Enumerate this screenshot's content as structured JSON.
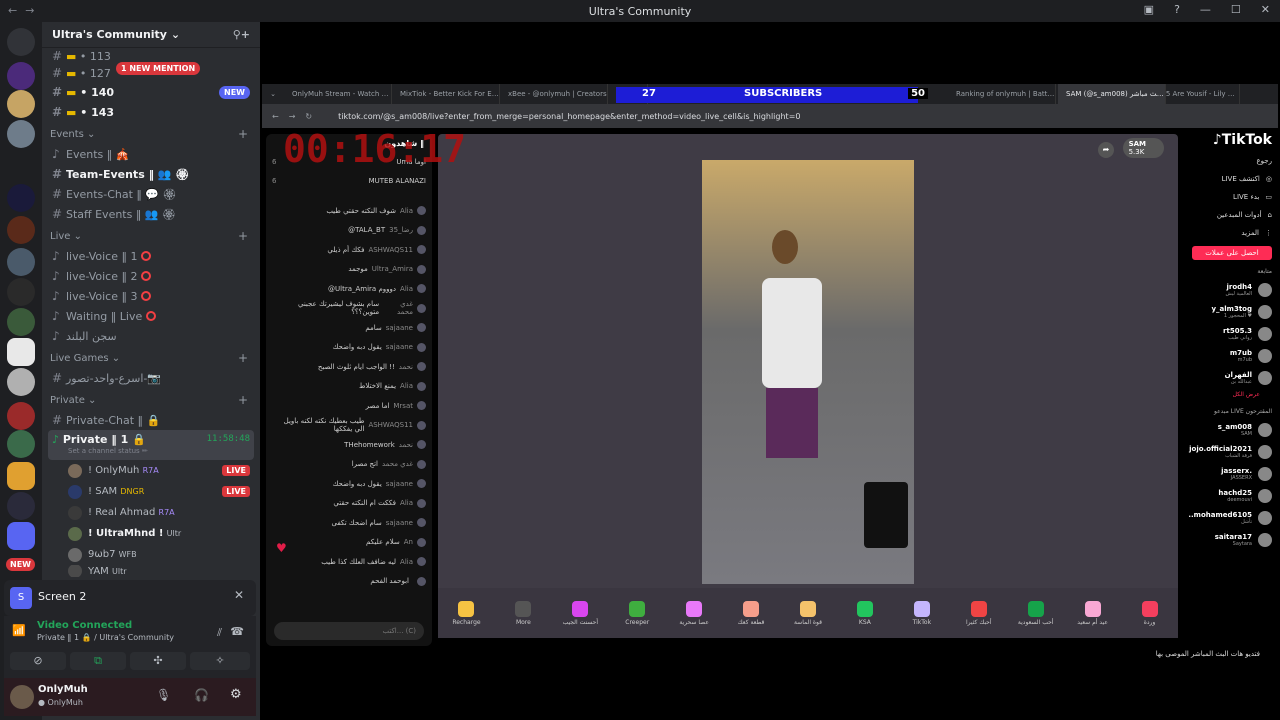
{
  "window": {
    "title": "Ultra's Community"
  },
  "guild": {
    "name": "Ultra's Community",
    "new_mention": "1 NEW MENTION"
  },
  "top_rows": [
    {
      "label": "• 113"
    },
    {
      "label": "• 127"
    },
    {
      "label": "• 140",
      "badge": "NEW"
    },
    {
      "label": "• 143"
    }
  ],
  "categories": {
    "events": "Events",
    "live": "Live",
    "live_games": "Live Games",
    "private": "Private"
  },
  "channels": {
    "events": [
      "Events ‖ 🎪",
      "Team-Events ‖ 👥 🏵",
      "Events-Chat ‖ 💬 🏵",
      "Staff Events ‖ 👥 🏵"
    ],
    "live": [
      "live-Voice ‖ 1",
      "live-Voice ‖ 2",
      "live-Voice ‖ 3",
      "Waiting ‖ Live",
      "سجن البلند"
    ],
    "live_games": [
      "اسرع-واحد-تصور-📷"
    ],
    "private_chat": "Private-Chat ‖ 🔒",
    "private_voice": "Private ‖ 1 🔒",
    "private_time": "11:58:48",
    "private_status": "Set a channel status ✏"
  },
  "voice_users": [
    {
      "name": "! OnlyMuh",
      "tag": "R7A",
      "live": "LIVE"
    },
    {
      "name": "! SAM",
      "tag": "DNGR",
      "live": "LIVE"
    },
    {
      "name": "! Real Ahmad",
      "tag": "R7A"
    },
    {
      "name": "! UltraMhnd !",
      "tag": "Ultr"
    },
    {
      "name": "9ωb7",
      "tag": "WFB"
    },
    {
      "name": "YAM",
      "tag": "Ultr"
    }
  ],
  "screen_panel": {
    "title": "Screen 2"
  },
  "voice_panel": {
    "status": "Video Connected",
    "detail": "Private ‖ 1 🔒 / Ultra's Community"
  },
  "user_panel": {
    "name": "OnlyMuh",
    "status": "● OnlyMuh",
    "new_badge": "NEW"
  },
  "browser": {
    "tabs": [
      "OnlyMuh Stream - Watch Live on K",
      "MixTiok - Better Kick For Everyone",
      "xBee - @onlymuh | Creators",
      "",
      "17755 Are Yousif - Lily of the",
      "Ranking of onlymuh | Battle -- C",
      "SAM (@s_am008) على بث مباشر"
    ],
    "url": "tiktok.com/@s_am008/live?enter_from_merge=personal_homepage&enter_method=video_live_cell&is_highlight=0"
  },
  "overlay": {
    "left_num": "27",
    "label": "SUBSCRIBERS",
    "right_num": "50",
    "timer": "00:16:17"
  },
  "chat": {
    "header": "شاهدون ‖",
    "top_viewers": [
      {
        "rank": "6",
        "name": "Uma اوما"
      },
      {
        "rank": "6",
        "name": "MUTEB ALANAZI"
      }
    ],
    "messages": [
      {
        "user": "Alia",
        "text": "شوف النكته حقتي طيب"
      },
      {
        "user": "رضا_35",
        "text": "@TALA_BT"
      },
      {
        "user": "ASHWAQS11",
        "text": "فكك أم ذيلي"
      },
      {
        "user": "Ultra_Amira",
        "text": "موجمد"
      },
      {
        "user": "Alia",
        "text": "@Ultra_Amira دوووم"
      },
      {
        "user": "غدي محمد",
        "text": "سام بشوف ليشيرتك عجبني متوين؟؟؟"
      },
      {
        "user": "sajaane",
        "text": "سامم"
      },
      {
        "user": "sajaane",
        "text": "يقول دبه واضحك"
      },
      {
        "user": "نحمد",
        "text": "الواجب ايام ثلوث الصبح !!"
      },
      {
        "user": "Alia",
        "text": "يمنع الاختلاط"
      },
      {
        "user": "Mrsat",
        "text": "اما مصر"
      },
      {
        "user": "ASHWAQS11",
        "text": "طيب بعطيك نكته لكنه باويل الي يفككها"
      },
      {
        "user": "نحمد",
        "text": "THehomework"
      },
      {
        "user": "غدي محمد",
        "text": "اتج مصرا"
      },
      {
        "user": "sajaane",
        "text": "يقول دبه واضحك"
      },
      {
        "user": "Alia",
        "text": "فككت ام النكته حقتي"
      },
      {
        "user": "sajaane",
        "text": "سام اضحك تكفى"
      },
      {
        "user": "An",
        "text": "سلام عليكم"
      },
      {
        "user": "Alia",
        "text": "ليه ضافف العلك كذا طيب"
      },
      {
        "user": "",
        "text": "ابوحمد الفحم"
      }
    ],
    "input_placeholder": "اكتب... (C)"
  },
  "stream_header": {
    "name": "SAM",
    "viewers": "5.3K"
  },
  "gifts": [
    {
      "label": "Recharge",
      "color": "#f6c343"
    },
    {
      "label": "More",
      "color": "#555555"
    },
    {
      "label": "أحسنت الجيب",
      "color": "#d946ef"
    },
    {
      "label": "Creeper",
      "color": "#3fae3f"
    },
    {
      "label": "عصا سحرية",
      "color": "#e879f9"
    },
    {
      "label": "قطعة كعك",
      "color": "#f59e8b"
    },
    {
      "label": "قوة الماسة",
      "color": "#f4c26b"
    },
    {
      "label": "KSA",
      "color": "#22c55e"
    },
    {
      "label": "TikTok",
      "color": "#c4b5fd"
    },
    {
      "label": "أحبك كثيرا",
      "color": "#ef4444"
    },
    {
      "label": "أحب السعودية",
      "color": "#16a34a"
    },
    {
      "label": "عيد أم سعيد",
      "color": "#f9a8d4"
    },
    {
      "label": "وردة",
      "color": "#f43f5e"
    }
  ],
  "tiktok_sidebar": {
    "logo": "TikTok",
    "nav": [
      "رجوع",
      "LIVE اكتشف",
      "LIVE بدء",
      "أدوات المبدعين",
      "المزيد"
    ],
    "cta": "احصل على عملات",
    "following_title": "متابعة",
    "following": [
      {
        "name": "jrodh4",
        "sub": "العالمية ‫ليش"
      },
      {
        "name": "y_alm3tog",
        "sub": "المحجور 1 ♥"
      },
      {
        "name": "rt505.3",
        "sub": "رواني طيب"
      },
      {
        "name": "m7ub",
        "sub": "m7ub"
      },
      {
        "name": "الفهران",
        "sub": "عبدالله بن"
      }
    ],
    "see_more": "عرض الكل",
    "live_title": "مبدعو LIVE المقترحون",
    "live_users": [
      {
        "name": "s_am008",
        "sub": "SAM"
      },
      {
        "name": "jojo.official2021",
        "sub": "فرقة الشباب"
      },
      {
        "name": "jasserx.",
        "sub": "JASSERX"
      },
      {
        "name": "hachd25",
        "sub": "deemouvi"
      },
      {
        "name": "..mohamed6105",
        "sub": "تأشل"
      },
      {
        "name": "saitara17",
        "sub": "Saytara"
      }
    ],
    "bottom_text": "فتديو هات البث المباشر الموصى بها"
  }
}
